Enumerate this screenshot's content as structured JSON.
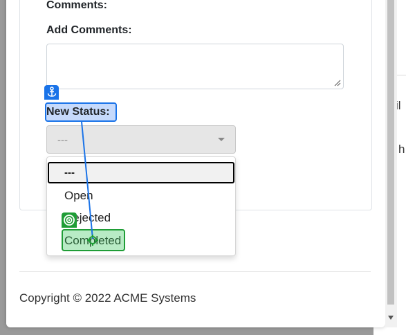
{
  "form": {
    "comments_label": "Comments:",
    "add_comments_label": "Add Comments:",
    "add_comments_value": "",
    "new_status_label": "New Status:",
    "status_select_value": "---"
  },
  "dropdown": {
    "options": [
      "---",
      "Open",
      "Rejected",
      "Completed"
    ],
    "selected_index": 0
  },
  "background_page": {
    "text_1": "il",
    "text_2": "h"
  },
  "footer": {
    "copyright": "Copyright © 2022 ACME Systems"
  },
  "annotations": {
    "anchor_color": "#1a73e8",
    "target_color": "#1f9d36",
    "anchor_icon": "anchor-icon",
    "target_icon": "target-icon"
  }
}
